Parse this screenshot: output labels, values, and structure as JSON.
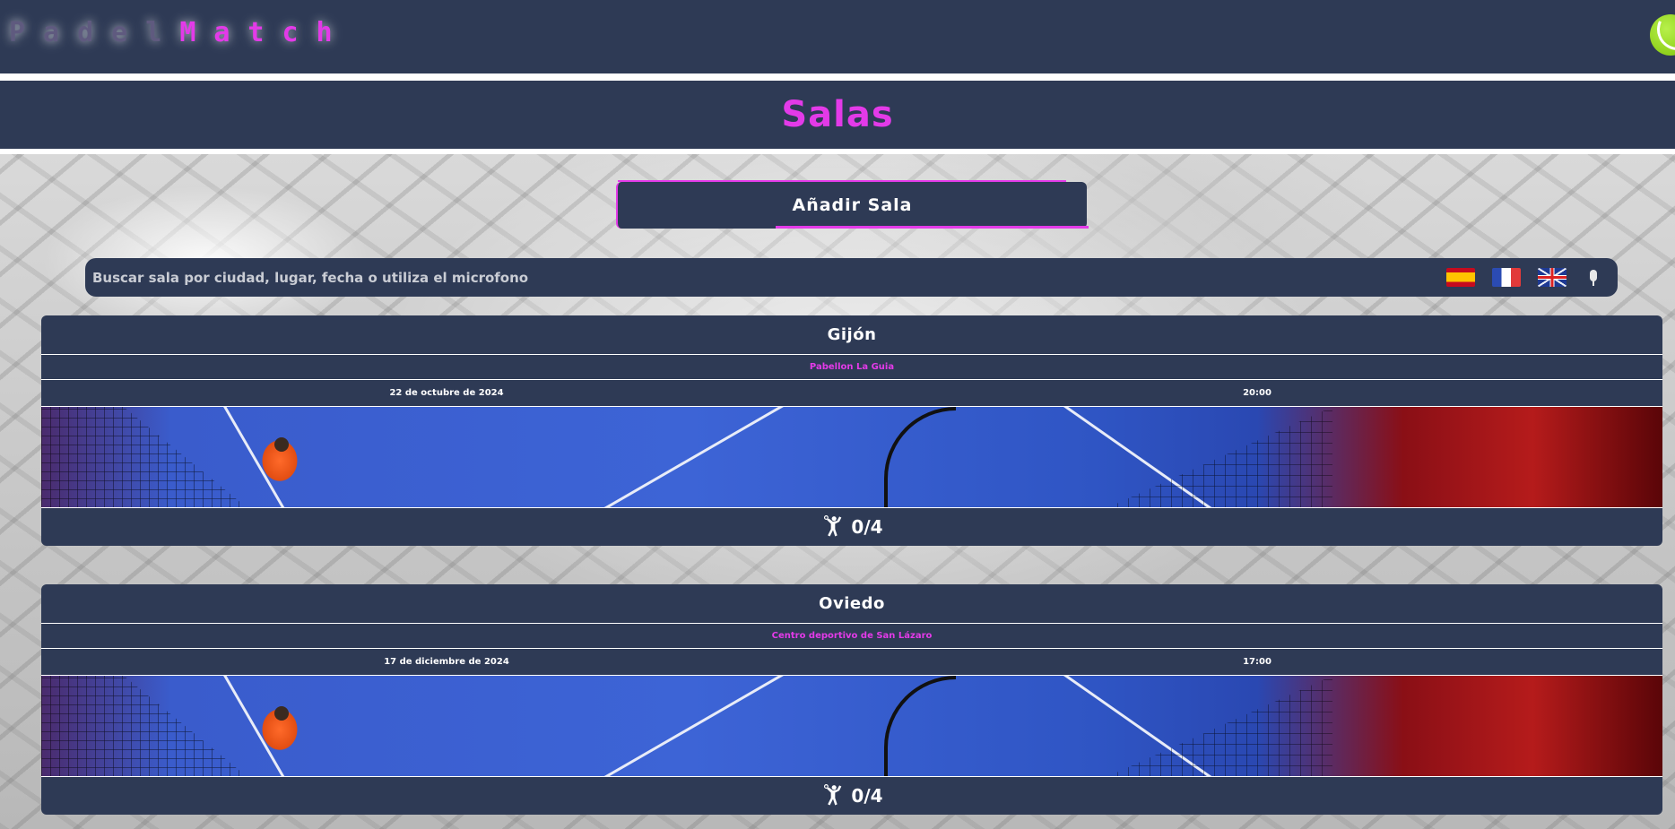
{
  "app": {
    "logo_part1": "Padel",
    "logo_part2": "Match",
    "logo_part1_chars": [
      "P",
      "a",
      "d",
      "e",
      "l"
    ],
    "logo_part2_chars": [
      "M",
      "a",
      "t",
      "c",
      "h"
    ]
  },
  "page": {
    "title": "Salas"
  },
  "actions": {
    "add_room_label": "Añadir Sala"
  },
  "search": {
    "placeholder": "Buscar sala por ciudad, lugar, fecha o utiliza el microfono",
    "value": "",
    "languages": [
      "es",
      "fr",
      "en"
    ]
  },
  "rooms": [
    {
      "city": "Gijón",
      "place": "Pabellon La Guia",
      "date": "22 de octubre de 2024",
      "time": "20:00",
      "players": "0/4"
    },
    {
      "city": "Oviedo",
      "place": "Centro deportivo de San Lázaro",
      "date": "17 de diciembre de 2024",
      "time": "17:00",
      "players": "0/4"
    }
  ],
  "icons": {
    "ball": "tennis-ball-icon",
    "mic": "microphone-icon",
    "player": "player-icon"
  },
  "colors": {
    "panel": "#2e3a55",
    "accent": "#e33ae8",
    "text": "#ffffff"
  }
}
